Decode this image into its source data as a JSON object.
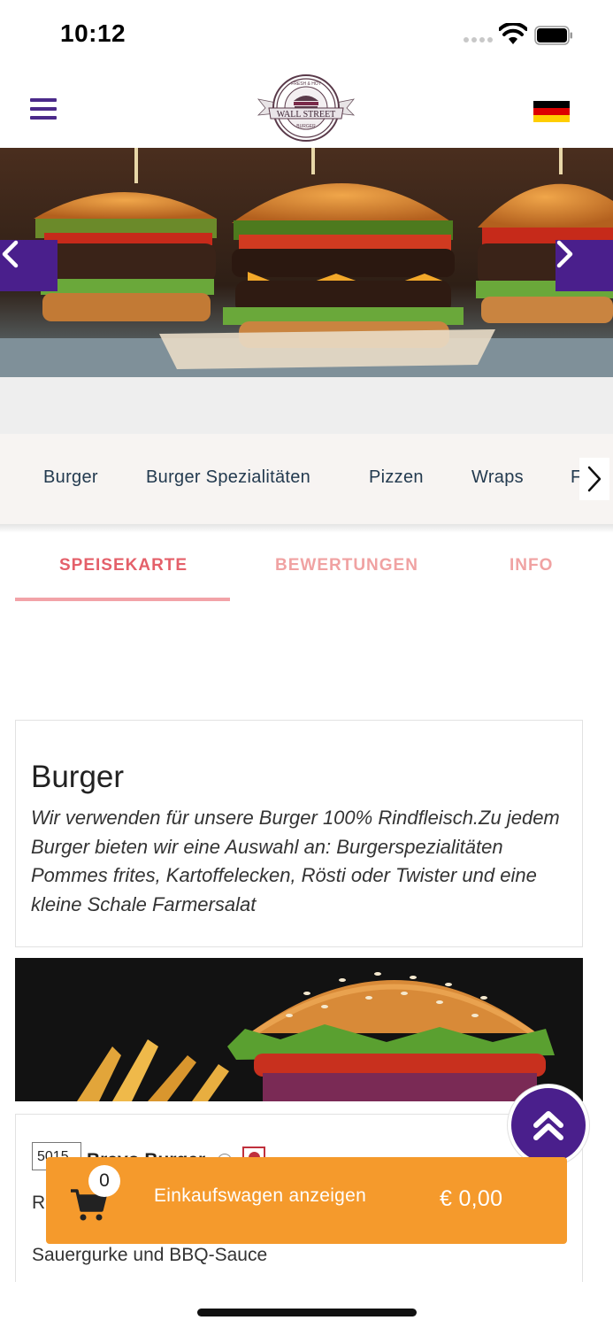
{
  "status_bar": {
    "time": "10:12"
  },
  "header": {
    "menu_icon": "hamburger-icon",
    "logo_text": "WALL STREET",
    "logo_small_top": "FRESH & HOT",
    "logo_small_bottom": "BURGER",
    "language_flag": "de-flag"
  },
  "hero": {
    "prev_icon": "chevron-left-icon",
    "next_icon": "chevron-right-icon"
  },
  "categories": {
    "items": [
      "Burger",
      "Burger Spezialitäten",
      "Pizzen",
      "Wraps",
      "Fi"
    ],
    "next_icon": "chevron-right-icon"
  },
  "tabs": [
    {
      "label": "SPEISEKARTE",
      "active": true
    },
    {
      "label": "BEWERTUNGEN",
      "active": false
    },
    {
      "label": "INFO",
      "active": false
    }
  ],
  "section": {
    "title": "Burger",
    "description": "Wir verwenden für unsere Burger 100% Rindfleisch.Zu jedem Burger bieten wir eine Auswahl an: Burgerspezialitäten Pommes frites, Kartoffelecken, Rösti oder Twister und eine kleine Schale Farmersalat"
  },
  "product": {
    "number": "5015",
    "name": "Bravo Burger",
    "desc_line1": "R",
    "desc_line2": "Sauergurke und BBQ-Sauce"
  },
  "cart": {
    "count": "0",
    "label": "Einkaufswagen anzeigen",
    "price": "€ 0,00"
  },
  "colors": {
    "brand_purple": "#4a1f8c",
    "accent_orange": "#f59a2c",
    "tab_active": "#e4606a"
  }
}
